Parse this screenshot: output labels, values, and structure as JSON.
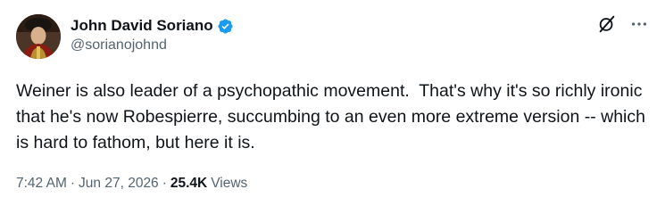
{
  "author": {
    "display_name": "John David Soriano",
    "handle": "@sorianojohnd",
    "verified": true,
    "verified_color": "#1d9bf0"
  },
  "tweet": {
    "text": "Weiner is also leader of a psychopathic movement.  That's why it's so richly ironic that he's now Robespierre, succumbing to an even more extreme version -- which is hard to fathom, but here it is."
  },
  "meta": {
    "time": "7:42 AM",
    "separator1": "·",
    "date": "Jun 27, 2026",
    "separator2": "·",
    "views_count": "25.4K",
    "views_label": "Views"
  },
  "icons": {
    "verified": "verified-badge-icon",
    "grok": "grok-icon",
    "more": "more-dots-icon"
  },
  "colors": {
    "text_primary": "#0f1419",
    "text_secondary": "#536471",
    "accent": "#1d9bf0"
  }
}
